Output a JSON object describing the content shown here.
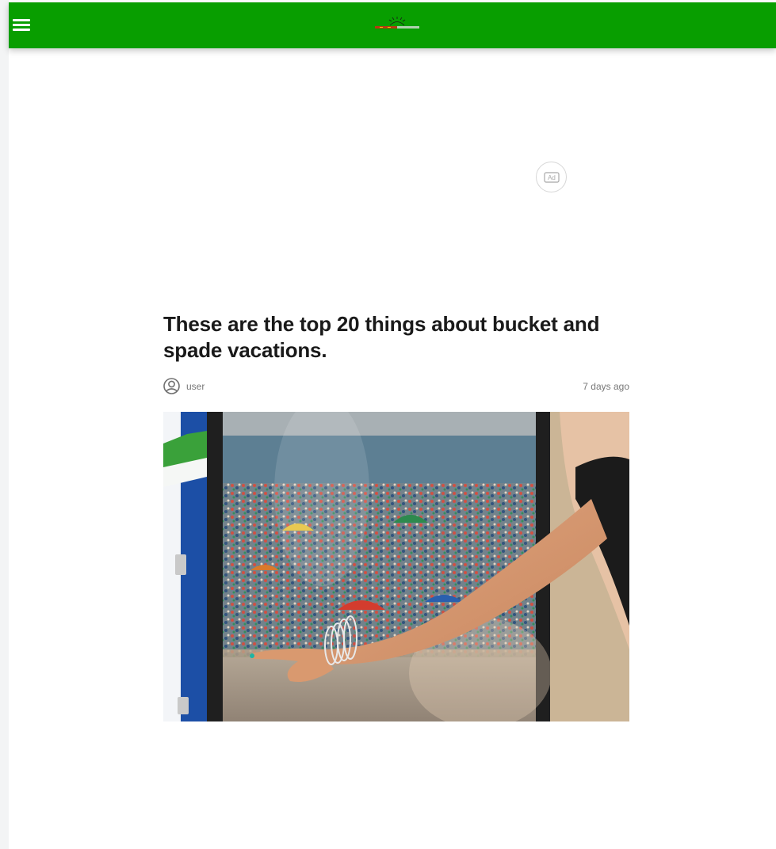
{
  "header": {
    "menu_icon": "hamburger-menu-icon",
    "logo": {
      "text": "",
      "icon": "site-logo"
    },
    "background": "#089e00"
  },
  "ad": {
    "badge_text": "Ad"
  },
  "article": {
    "title": "These are the top 20 things about bucket and spade vacations.",
    "author": "user",
    "date": "7 days ago",
    "avatar_icon": "user-avatar-icon",
    "hero_image_alt": ""
  }
}
